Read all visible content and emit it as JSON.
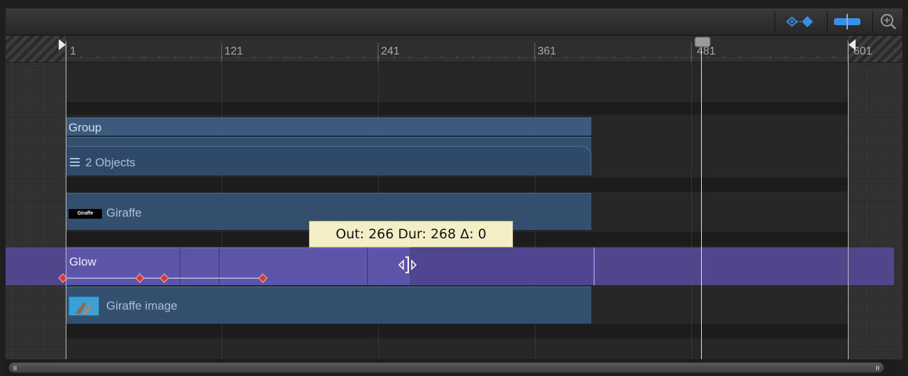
{
  "ruler": {
    "labels": [
      "1",
      "121",
      "241",
      "361",
      "481",
      "601"
    ]
  },
  "tracks": {
    "group_label": "Group",
    "group_objects_label": "2 Objects",
    "giraffe_label": "Giraffe",
    "giraffe_thumb_text": "Giraffe",
    "glow_label": "Glow",
    "giraffe_image_label": "Giraffe image"
  },
  "tooltip": {
    "text": "Out: 266 Dur: 268 Δ: 0"
  },
  "colors": {
    "clip_blue": "#34506f",
    "glow_purple": "#5d55a7",
    "keyframe_red": "#d23b3b",
    "toolbar_accent": "#3a8fe8"
  },
  "icons": {
    "keyframe_toggle": "keyframe-diamonds-icon",
    "snapping": "snapping-icon",
    "zoom": "zoom-icon",
    "list": "hamburger-icon"
  }
}
